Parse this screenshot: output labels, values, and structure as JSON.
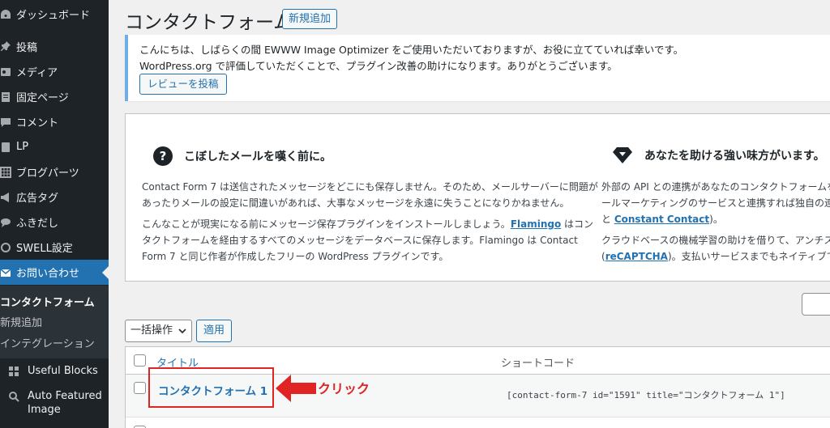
{
  "sidebar": {
    "items": [
      {
        "label": "ダッシュボード",
        "icon": "dashboard-icon"
      },
      {
        "label": "投稿",
        "icon": "pin-icon"
      },
      {
        "label": "メディア",
        "icon": "media-icon"
      },
      {
        "label": "固定ページ",
        "icon": "page-icon"
      },
      {
        "label": "コメント",
        "icon": "comment-icon"
      },
      {
        "label": "LP",
        "icon": "lp-icon"
      },
      {
        "label": "ブログパーツ",
        "icon": "grid-icon"
      },
      {
        "label": "広告タグ",
        "icon": "megaphone-icon"
      },
      {
        "label": "ふきだし",
        "icon": "speech-bubble-icon"
      },
      {
        "label": "SWELL設定",
        "icon": "swell-icon"
      },
      {
        "label": "お問い合わせ",
        "icon": "mail-icon"
      },
      {
        "label": "Useful Blocks",
        "icon": "blocks-icon"
      },
      {
        "label": "Auto Featured",
        "label2": "Image",
        "icon": "image-icon"
      }
    ],
    "submenu": [
      "コンタクトフォーム",
      "新規追加",
      "インテグレーション"
    ]
  },
  "header": {
    "title": "コンタクトフォーム",
    "add_new": "新規追加"
  },
  "notice": {
    "line1": "こんにちは、しばらくの間 EWWW Image Optimizer をご使用いただいておりますが、お役に立てていれば幸いです。",
    "line2": "WordPress.org で評価していただくことで、プラグイン改善の助けになります。ありがとうございます。",
    "button": "レビューを投稿"
  },
  "welcome": {
    "left_heading": "こぼしたメールを嘆く前に。",
    "left_p1_l1": "Contact Form 7 は送信されたメッセージをどこにも保存しません。そのため、メールサーバーに問題が",
    "left_p1_l2": "あったりメールの設定に間違いがあれば、大事なメッセージを永遠に失うことになりかねません。",
    "left_p2_l1a": "こんなことが現実になる前にメッセージ保存プラグインをインストールしましょう。",
    "left_p2_link": "Flamingo",
    "left_p2_l1b": " はコン",
    "left_p2_l2": "タクトフォームを経由するすべてのメッセージをデータベースに保存します。Flamingo は Contact",
    "left_p2_l3": "Form 7 と同じ作者が作成したフリーの WordPress プラグインです。",
    "right_heading": "あなたを助ける強い味方がいます。",
    "right_p1_l1": "外部の API との連携があなたのコンタクトフォームを",
    "right_p1_l2": "ールマーケティングのサービスと連携すれば独自の連",
    "right_p1_l3a": "と ",
    "right_p1_link": "Constant Contact",
    "right_p1_l3b": ")。",
    "right_p2_l1": "クラウドベースの機械学習の助けを借りて、アンチス",
    "right_p2_l2a": "(",
    "right_p2_link": "reCAPTCHA",
    "right_p2_l2b": ")。支払いサービスまでもネイティブでサ"
  },
  "toolbar": {
    "bulk": "一括操作",
    "apply": "適用"
  },
  "table": {
    "col_title": "タイトル",
    "col_shortcode": "ショートコード",
    "rows": [
      {
        "title": "コンタクトフォーム 1",
        "shortcode": "[contact-form-7 id=\"1591\" title=\"コンタクトフォーム 1\"]"
      }
    ]
  },
  "annotation": {
    "label": "クリック",
    "color": "#e02424"
  },
  "colors": {
    "accent": "#2271b1",
    "sidebar_bg": "#1d2327",
    "active_bg": "#2271b1"
  }
}
